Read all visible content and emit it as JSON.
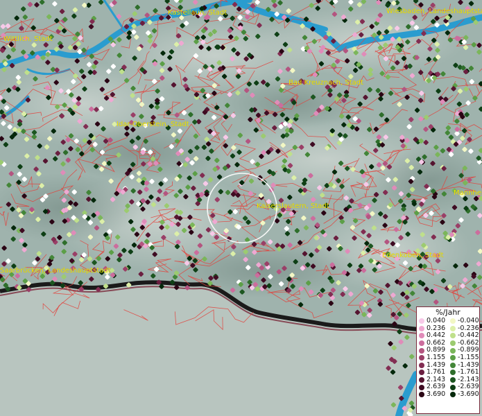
{
  "map": {
    "cities": [
      {
        "name": "Kastellaun, Stadt"
      },
      {
        "name": "Wiesbaden, Landeshauptstadt"
      },
      {
        "name": "Wittlich, Stadt"
      },
      {
        "name": "Bad Kreuznach, Stadt"
      },
      {
        "name": "Idar-Oberstein, Stadt"
      },
      {
        "name": "Kaiserslautern, Stadt"
      },
      {
        "name": "Mannheim"
      },
      {
        "name": "Saarbrücken, Landeshauptstadt"
      },
      {
        "name": "Edenkoben, Stadt"
      }
    ],
    "legend": {
      "title": "%/Jahr",
      "positive": [
        {
          "value": "0.040",
          "color": "#f7c9e8"
        },
        {
          "value": "0.236",
          "color": "#efa8d2"
        },
        {
          "value": "0.442",
          "color": "#e08bb9"
        },
        {
          "value": "0.662",
          "color": "#cc6d9d"
        },
        {
          "value": "0.899",
          "color": "#b45580"
        },
        {
          "value": "1.155",
          "color": "#9a3f67"
        },
        {
          "value": "1.439",
          "color": "#822d52"
        },
        {
          "value": "1.761",
          "color": "#6b1f40"
        },
        {
          "value": "2.143",
          "color": "#551430"
        },
        {
          "value": "2.639",
          "color": "#3f0b22"
        },
        {
          "value": "3.690",
          "color": "#2a0514"
        }
      ],
      "negative": [
        {
          "value": "-0.040",
          "color": "#f2f7c4"
        },
        {
          "value": "-0.236",
          "color": "#dcefa8"
        },
        {
          "value": "-0.442",
          "color": "#bfe08b"
        },
        {
          "value": "-0.662",
          "color": "#9ccb70"
        },
        {
          "value": "-0.899",
          "color": "#7bb65a"
        },
        {
          "value": "-1.155",
          "color": "#5c9f47"
        },
        {
          "value": "-1.439",
          "color": "#438638"
        },
        {
          "value": "-1.761",
          "color": "#2e6e2b"
        },
        {
          "value": "-2.143",
          "color": "#1c5620"
        },
        {
          "value": "-2.639",
          "color": "#0e3f15"
        },
        {
          "value": "-3.690",
          "color": "#04280b"
        }
      ]
    },
    "colors": {
      "terrain": "#9fb3ad",
      "water": "#2a9ccf",
      "district_border": "#e3413b",
      "country_border": "#1a1a1a",
      "label": "#f2e600"
    }
  }
}
